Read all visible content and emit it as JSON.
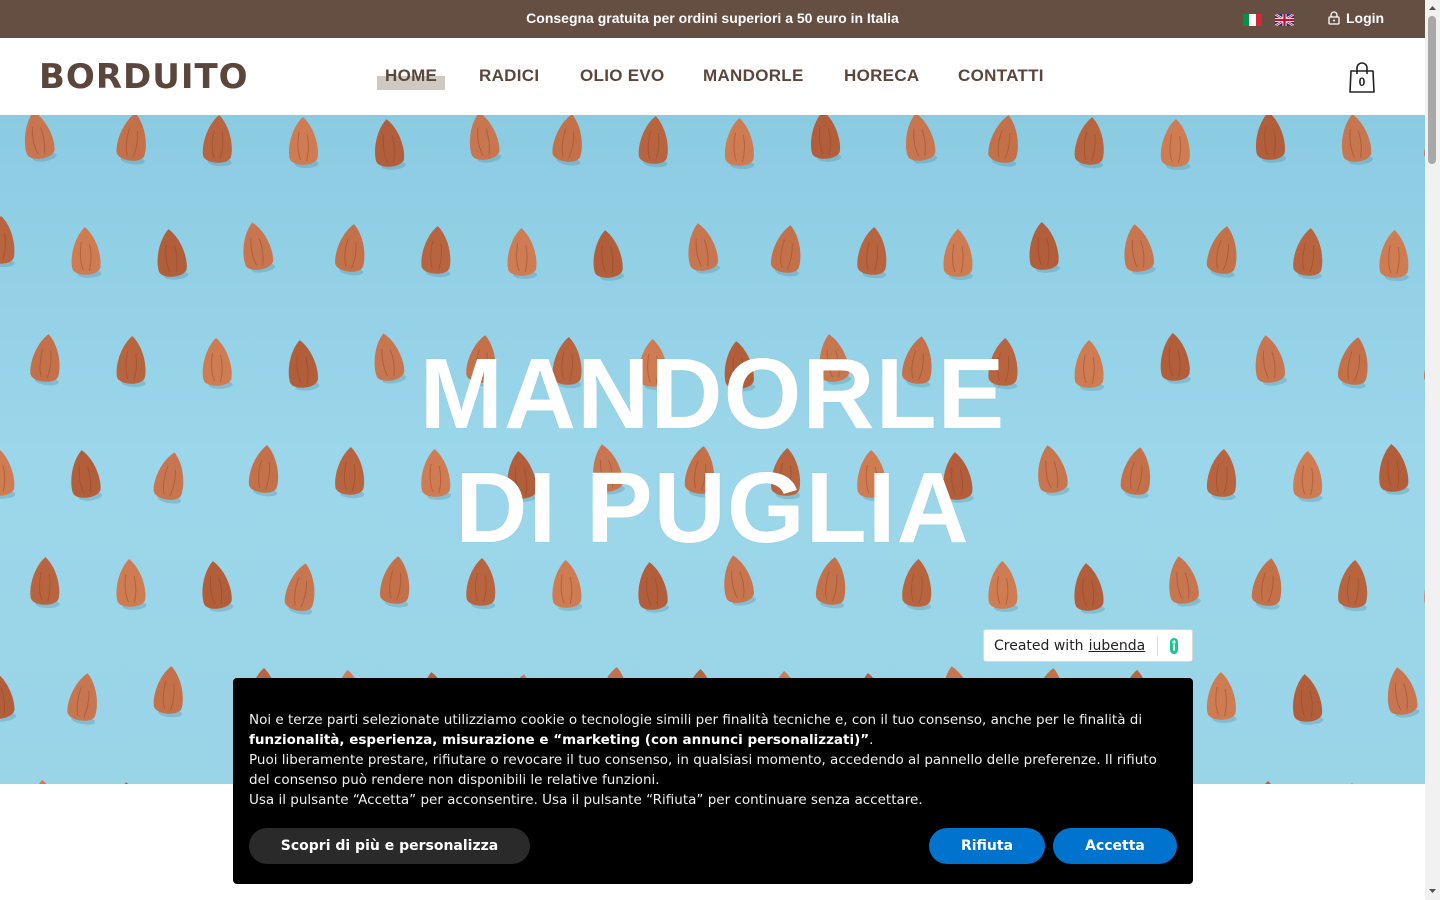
{
  "topbar": {
    "promo": "Consegna gratuita per ordini superiori a 50 euro in Italia",
    "login": "Login",
    "languages": [
      "it",
      "en"
    ]
  },
  "header": {
    "logo": "BORDUITO",
    "nav": [
      "HOME",
      "RADICI",
      "OLIO EVO",
      "MANDORLE",
      "HORECA",
      "CONTATTI"
    ],
    "active_nav": "HOME",
    "cart_count": "0"
  },
  "hero": {
    "title_line1": "MANDORLE",
    "title_line2": "DI PUGLIA"
  },
  "iubenda": {
    "prefix": "Created with",
    "link": "iubenda"
  },
  "cookie": {
    "line1": "Noi e terze parti selezionate utilizziamo cookie o tecnologie simili per finalità tecniche e, con il tuo consenso, anche per le finalità di",
    "line2_bold": "funzionalità, esperienza, misurazione e “marketing (con annunci personalizzati)”",
    "line2_end": ".",
    "line3": "Puoi liberamente prestare, rifiutare o revocare il tuo consenso, in qualsiasi momento, accedendo al pannello delle preferenze. Il rifiuto del consenso può rendere non disponibili le relative funzioni.",
    "line4": "Usa il pulsante “Accetta” per acconsentire. Usa il pulsante “Rifiuta” per continuare senza accettare.",
    "btn_more": "Scopri di più e personalizza",
    "btn_reject": "Rifiuta",
    "btn_accept": "Accetta"
  },
  "colors": {
    "topbar": "#654f43",
    "brand": "#5b463b",
    "hero_bg": "#9bd6ea",
    "almond": "#c4714a",
    "button_blue": "#0073ce"
  }
}
